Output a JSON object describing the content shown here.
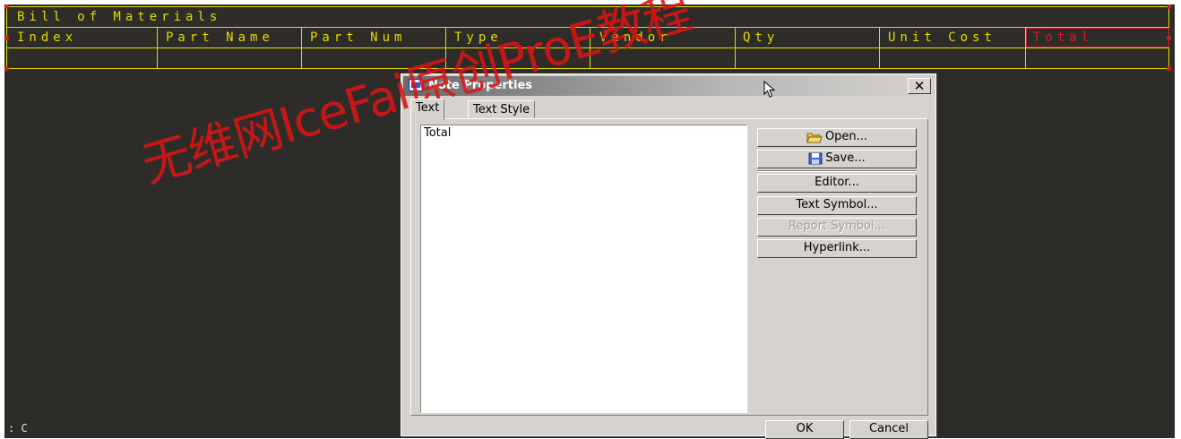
{
  "bom": {
    "title": "Bill of Materials",
    "columns": [
      "Index",
      "Part Name",
      "Part Num",
      "Type",
      "Vendor",
      "Qty",
      "Unit Cost",
      "Total"
    ]
  },
  "status_prompt": ": C",
  "watermark": "无维网IceFai原创ProE教程",
  "dialog": {
    "title": "Note Properties",
    "close_label": "✕",
    "tabs": [
      "Text",
      "Text Style"
    ],
    "text_value": "Total",
    "buttons": {
      "open": "Open...",
      "save": "Save...",
      "editor": "Editor...",
      "text_symbol": "Text Symbol...",
      "report_symbol": "Report Symbol...",
      "hyperlink": "Hyperlink..."
    },
    "ok": "OK",
    "cancel": "Cancel"
  },
  "colors": {
    "canvas": "#2e2c29",
    "table_lines": "#e6d800",
    "selection": "#d81e1e",
    "dialog_face": "#d6d3ce"
  },
  "icons": [
    "folder-open-icon",
    "floppy-save-icon",
    "note-window-icon",
    "arrow-cursor-icon"
  ]
}
